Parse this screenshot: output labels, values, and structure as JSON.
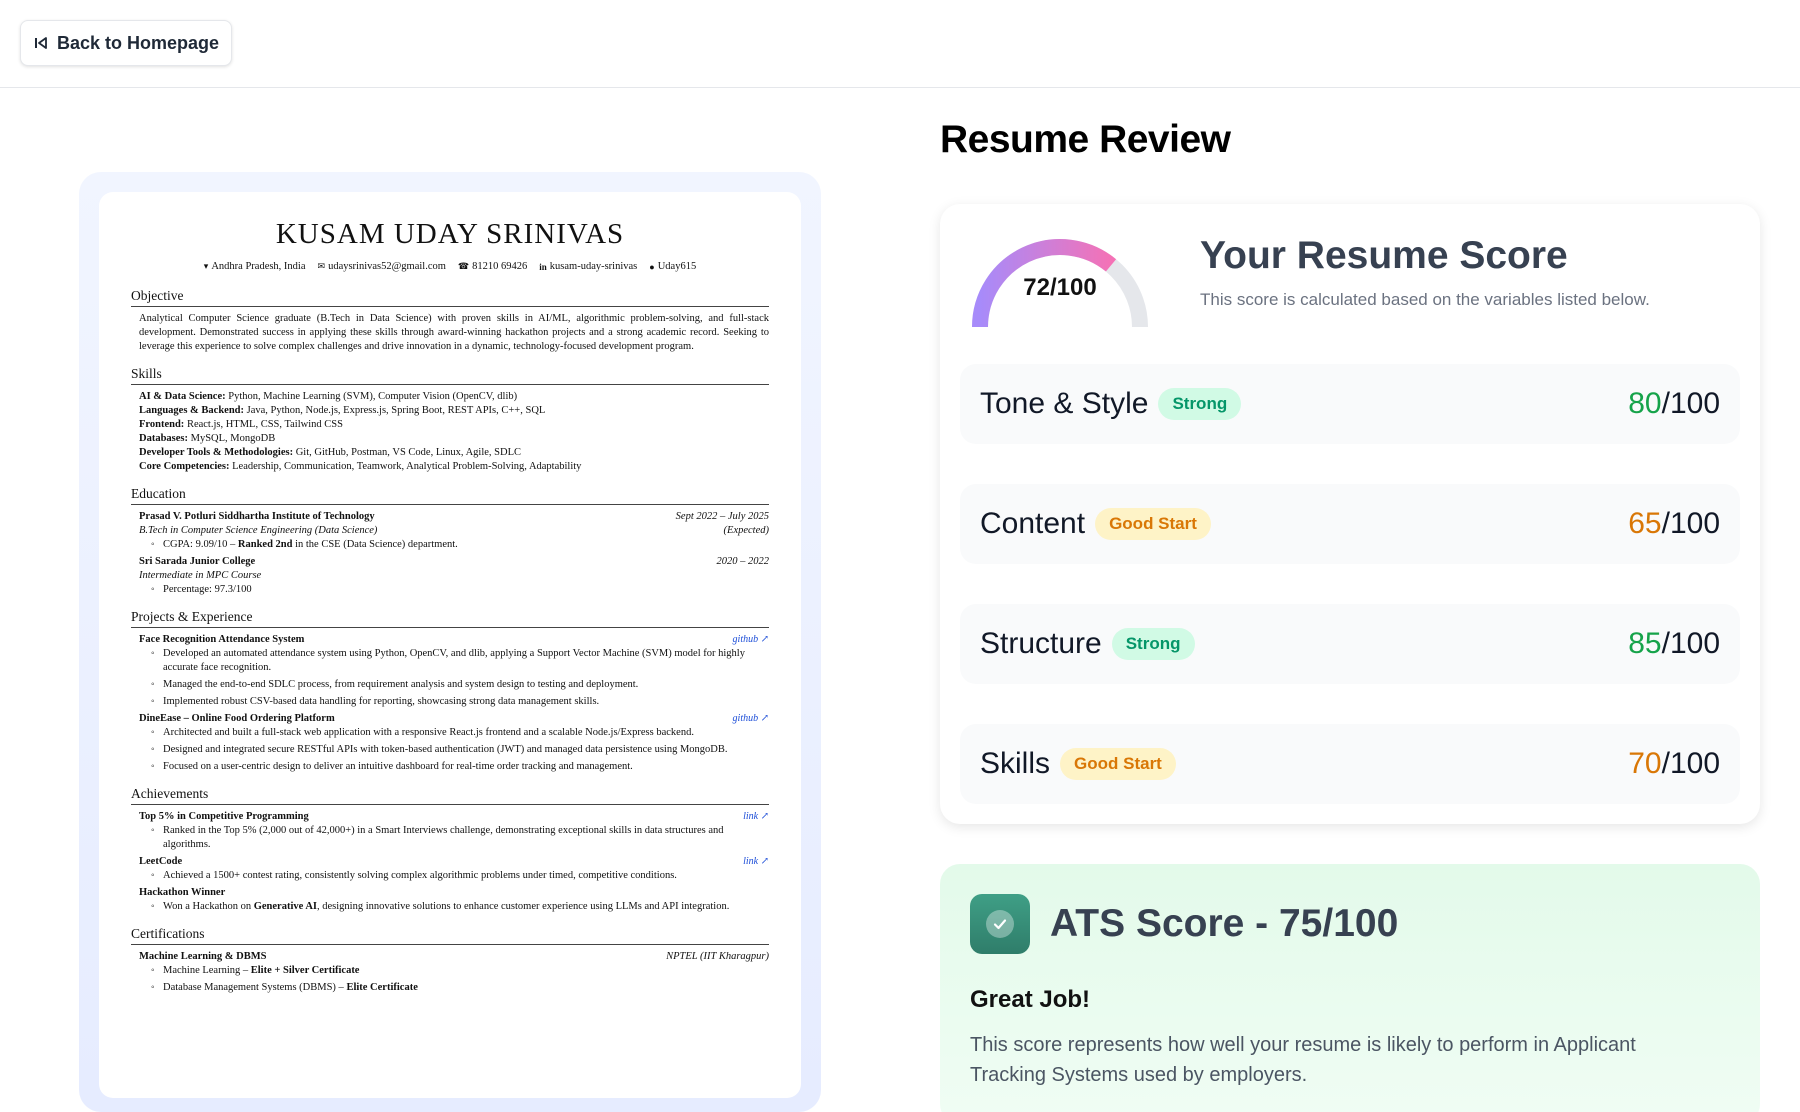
{
  "topbar": {
    "back_label": "Back to Homepage"
  },
  "resume": {
    "name": "KUSAM UDAY SRINIVAS",
    "contact": [
      {
        "icon": "location-icon",
        "glyph": "▾",
        "text": "Andhra Pradesh, India"
      },
      {
        "icon": "mail-icon",
        "glyph": "✉",
        "text": "udaysrinivas52@gmail.com"
      },
      {
        "icon": "phone-icon",
        "glyph": "☎",
        "text": "81210 69426"
      },
      {
        "icon": "linkedin-icon",
        "glyph": "in",
        "text": "kusam-uday-srinivas"
      },
      {
        "icon": "github-icon",
        "glyph": "●",
        "text": "Uday615"
      }
    ],
    "objective_title": "Objective",
    "objective": "Analytical Computer Science graduate (B.Tech in Data Science) with proven skills in AI/ML, algorithmic problem-solving, and full-stack development. Demonstrated success in applying these skills through award-winning hackathon projects and a strong academic record. Seeking to leverage this experience to solve complex challenges and drive innovation in a dynamic, technology-focused development program.",
    "skills_title": "Skills",
    "skills": [
      {
        "label": "AI & Data Science:",
        "value": " Python, Machine Learning (SVM), Computer Vision (OpenCV, dlib)"
      },
      {
        "label": "Languages & Backend:",
        "value": " Java, Python, Node.js, Express.js, Spring Boot, REST APIs, C++, SQL"
      },
      {
        "label": "Frontend:",
        "value": " React.js, HTML, CSS, Tailwind CSS"
      },
      {
        "label": "Databases:",
        "value": " MySQL, MongoDB"
      },
      {
        "label": "Developer Tools & Methodologies:",
        "value": " Git, GitHub, Postman, VS Code, Linux, Agile, SDLC"
      },
      {
        "label": "Core Competencies:",
        "value": " Leadership, Communication, Teamwork, Analytical Problem-Solving, Adaptability"
      }
    ],
    "education_title": "Education",
    "edu1": {
      "school": "Prasad V. Potluri Siddhartha Institute of Technology",
      "dates": "Sept 2022 – July 2025",
      "degree": "B.Tech in Computer Science Engineering (Data Science)",
      "expected": "(Expected)",
      "gpa_pre": "CGPA: 9.09/10 – ",
      "gpa_bold": "Ranked 2nd",
      "gpa_post": " in the CSE (Data Science) department."
    },
    "edu2": {
      "school": "Sri Sarada Junior College",
      "dates": "2020 – 2022",
      "degree": "Intermediate in MPC Course",
      "pct": "Percentage: 97.3/100"
    },
    "projects_title": "Projects & Experience",
    "proj1": {
      "name": "Face Recognition Attendance System",
      "link": "github",
      "bullets": [
        "Developed an automated attendance system using Python, OpenCV, and dlib, applying a Support Vector Machine (SVM) model for highly accurate face recognition.",
        "Managed the end-to-end SDLC process, from requirement analysis and system design to testing and deployment.",
        "Implemented robust CSV-based data handling for reporting, showcasing strong data management skills."
      ]
    },
    "proj2": {
      "name": "DineEase – Online Food Ordering Platform",
      "link": "github",
      "bullets": [
        "Architected and built a full-stack web application with a responsive React.js frontend and a scalable Node.js/Express backend.",
        "Designed and integrated secure RESTful APIs with token-based authentication (JWT) and managed data persistence using MongoDB.",
        "Focused on a user-centric design to deliver an intuitive dashboard for real-time order tracking and management."
      ]
    },
    "achievements_title": "Achievements",
    "ach1": {
      "name": "Top 5% in Competitive Programming",
      "link": "link",
      "bullet": "Ranked in the Top 5% (2,000 out of 42,000+) in a Smart Interviews challenge, demonstrating exceptional skills in data structures and algorithms."
    },
    "ach2": {
      "name": "LeetCode",
      "link": "link",
      "bullet": "Achieved a 1500+ contest rating, consistently solving complex algorithmic problems under timed, competitive conditions."
    },
    "ach3": {
      "name": "Hackathon Winner",
      "bullet_pre": "Won a Hackathon on ",
      "bullet_bold": "Generative AI",
      "bullet_post": ", designing innovative solutions to enhance customer experience using LLMs and API integration."
    },
    "certs_title": "Certifications",
    "cert": {
      "name": "Machine Learning & DBMS",
      "issuer": "NPTEL (IIT Kharagpur)",
      "b1_pre": "Machine Learning – ",
      "b1_bold": "Elite + Silver Certificate",
      "b2_pre": "Database Management Systems (DBMS) – ",
      "b2_bold": "Elite Certificate"
    }
  },
  "review": {
    "title": "Resume Review",
    "score_title": "Your Resume Score",
    "score_sub": "This score is calculated based on the variables listed below.",
    "gauge_label": "72/100",
    "gauge_fraction": 0.72,
    "gauge_colors": [
      "#a78bfa",
      "#f472b6"
    ],
    "categories": [
      {
        "name": "Tone & Style",
        "badge": "Strong",
        "score": "80",
        "out_of": "/100"
      },
      {
        "name": "Content",
        "badge": "Good Start",
        "score": "65",
        "out_of": "/100"
      },
      {
        "name": "Structure",
        "badge": "Strong",
        "score": "85",
        "out_of": "/100"
      },
      {
        "name": "Skills",
        "badge": "Good Start",
        "score": "70",
        "out_of": "/100"
      }
    ]
  },
  "ats": {
    "title": "ATS Score - 75/100",
    "headline": "Great Job!",
    "description": "This score represents how well your resume is likely to perform in Applicant Tracking Systems used by employers."
  }
}
